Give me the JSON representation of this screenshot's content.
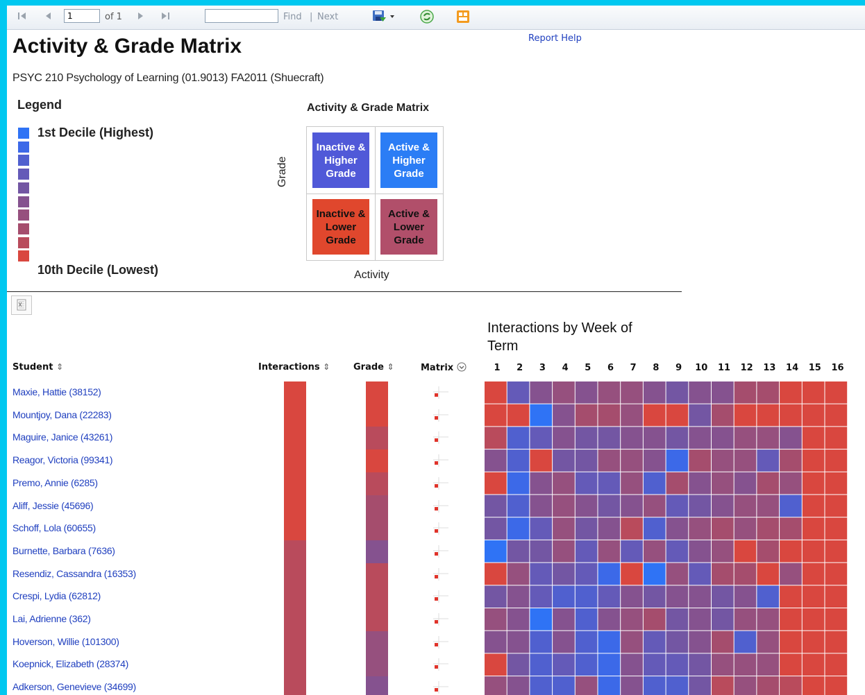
{
  "toolbar": {
    "first_icon": "first-page-icon",
    "prev_icon": "prev-page-icon",
    "page_value": "1",
    "page_of": "of 1",
    "next_icon": "next-page-icon",
    "last_icon": "last-page-icon",
    "find_value": "",
    "find_label": "Find",
    "separator": "|",
    "next_label": "Next",
    "export_icon": "save-export-icon",
    "refresh_icon": "refresh-icon",
    "print_icon": "print-layout-icon"
  },
  "header": {
    "title": "Activity & Grade Matrix",
    "help_link": "Report Help",
    "course": "PSYC 210 Psychology of Learning (01.9013) FA2011 (Shuecraft)"
  },
  "legend": {
    "title": "Legend",
    "high_label": "1st Decile (Highest)",
    "low_label": "10th Decile (Lowest)",
    "decile_colors": [
      "#2f73f5",
      "#3c69e8",
      "#5060cf",
      "#645ab8",
      "#7356a3",
      "#85528f",
      "#96507e",
      "#a54d6d",
      "#b94b5c",
      "#d9473f"
    ]
  },
  "matrix_key": {
    "title": "Activity & Grade Matrix",
    "y_label": "Grade",
    "x_label": "Activity",
    "q_inactive_higher": [
      "Inactive &",
      "Higher",
      "Grade"
    ],
    "q_active_higher": [
      "Active &",
      "Higher",
      "Grade"
    ],
    "q_inactive_lower": [
      "Inactive &",
      "Lower",
      "Grade"
    ],
    "q_active_lower": [
      "Active &",
      "Lower",
      "Grade"
    ],
    "colors": {
      "inactive_higher": "#5059d8",
      "active_higher": "#2b7df5",
      "inactive_lower": "#e0472d",
      "active_lower": "#b14f6a"
    }
  },
  "table": {
    "export_icon": "excel-export-icon",
    "week_title": "Interactions by Week of Term",
    "col_student": "Student",
    "col_interactions": "Interactions",
    "col_grade": "Grade",
    "col_matrix": "Matrix",
    "sort_icon": "sort-arrows-icon",
    "matrix_menu_icon": "circle-chevron-down-icon",
    "weeks": [
      "1",
      "2",
      "3",
      "4",
      "5",
      "6",
      "7",
      "8",
      "9",
      "10",
      "11",
      "12",
      "13",
      "14",
      "15",
      "16"
    ],
    "rows": [
      {
        "name": "Maxie, Hattie (38152)",
        "interactions": 10,
        "grade": 10,
        "weeks": [
          10,
          4,
          6,
          7,
          6,
          7,
          7,
          6,
          5,
          6,
          6,
          8,
          8,
          10,
          10,
          10
        ]
      },
      {
        "name": "Mountjoy, Dana (22283)",
        "interactions": 10,
        "grade": 10,
        "weeks": [
          10,
          10,
          1,
          6,
          8,
          8,
          7,
          10,
          10,
          5,
          8,
          10,
          10,
          10,
          10,
          10
        ]
      },
      {
        "name": "Maguire, Janice (43261)",
        "interactions": 10,
        "grade": 9,
        "weeks": [
          9,
          3,
          4,
          6,
          5,
          5,
          6,
          6,
          5,
          6,
          6,
          7,
          7,
          6,
          10,
          10
        ]
      },
      {
        "name": "Reagor, Victoria (99341)",
        "interactions": 10,
        "grade": 10,
        "weeks": [
          6,
          3,
          10,
          5,
          5,
          7,
          7,
          6,
          2,
          8,
          7,
          7,
          4,
          8,
          10,
          10
        ]
      },
      {
        "name": "Premo, Annie (6285)",
        "interactions": 10,
        "grade": 9,
        "weeks": [
          10,
          2,
          6,
          7,
          4,
          4,
          7,
          3,
          8,
          6,
          7,
          6,
          8,
          7,
          10,
          10
        ]
      },
      {
        "name": "Aliff, Jessie (45696)",
        "interactions": 10,
        "grade": 8,
        "weeks": [
          5,
          3,
          6,
          7,
          6,
          5,
          6,
          7,
          4,
          5,
          6,
          7,
          7,
          3,
          10,
          10
        ]
      },
      {
        "name": "Schoff, Lola (60655)",
        "interactions": 10,
        "grade": 8,
        "weeks": [
          5,
          2,
          4,
          7,
          5,
          6,
          9,
          3,
          6,
          7,
          8,
          7,
          8,
          8,
          10,
          10
        ]
      },
      {
        "name": "Burnette, Barbara (7636)",
        "interactions": 9,
        "grade": 6,
        "weeks": [
          1,
          5,
          5,
          7,
          4,
          7,
          4,
          7,
          4,
          6,
          7,
          10,
          8,
          10,
          10,
          10
        ]
      },
      {
        "name": "Resendiz, Cassandra (16353)",
        "interactions": 9,
        "grade": 9,
        "weeks": [
          10,
          7,
          4,
          5,
          4,
          2,
          10,
          1,
          7,
          4,
          8,
          8,
          10,
          7,
          10,
          10
        ]
      },
      {
        "name": "Crespi, Lydia (62812)",
        "interactions": 9,
        "grade": 9,
        "weeks": [
          5,
          6,
          4,
          3,
          3,
          4,
          6,
          5,
          6,
          6,
          5,
          6,
          3,
          10,
          10,
          10
        ]
      },
      {
        "name": "Lai, Adrienne (362)",
        "interactions": 9,
        "grade": 9,
        "weeks": [
          7,
          6,
          1,
          6,
          3,
          6,
          7,
          8,
          5,
          6,
          5,
          7,
          7,
          10,
          10,
          10
        ]
      },
      {
        "name": "Hoverson, Willie (101300)",
        "interactions": 9,
        "grade": 7,
        "weeks": [
          6,
          6,
          3,
          6,
          3,
          2,
          7,
          4,
          5,
          6,
          8,
          3,
          7,
          10,
          10,
          10
        ]
      },
      {
        "name": "Koepnick, Elizabeth (28374)",
        "interactions": 9,
        "grade": 7,
        "weeks": [
          10,
          5,
          3,
          4,
          3,
          2,
          6,
          4,
          4,
          5,
          7,
          7,
          7,
          10,
          10,
          10
        ]
      },
      {
        "name": "Adkerson, Genevieve (34699)",
        "interactions": 9,
        "grade": 6,
        "weeks": [
          7,
          6,
          3,
          3,
          7,
          2,
          6,
          3,
          3,
          5,
          9,
          7,
          8,
          9,
          10,
          10
        ]
      }
    ]
  }
}
